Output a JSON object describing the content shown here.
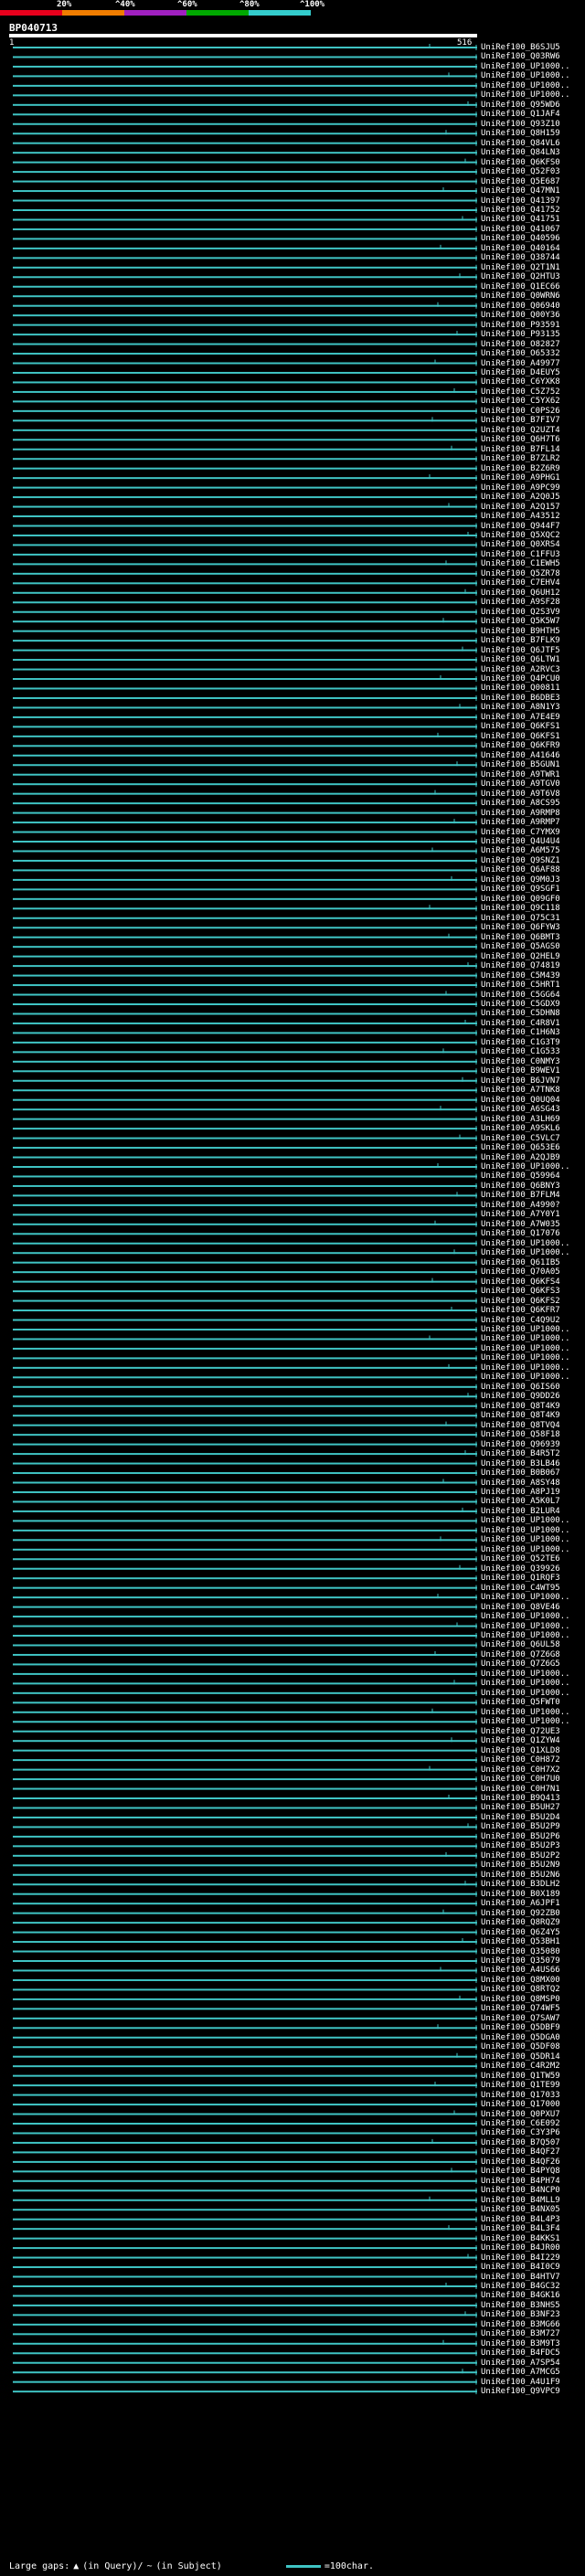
{
  "scale": {
    "labels": [
      "20%",
      "^40%",
      "^60%",
      "^80%",
      "^100%"
    ],
    "colors": [
      "#e8001c",
      "#f07d00",
      "#a020c0",
      "#00a800",
      "#33cccc"
    ]
  },
  "query": {
    "id": "BP040713",
    "start": "1",
    "end": "516"
  },
  "hit_color": "#3fc4c4",
  "hits": [
    "UniRef100_B6SJU5",
    "UniRef100_Q03RW6",
    "UniRef100_UP1000..",
    "UniRef100_UP1000..",
    "UniRef100_UP1000..",
    "UniRef100_UP1000..",
    "UniRef100_Q95WD6",
    "UniRef100_Q1JAF4",
    "UniRef100_Q93Z10",
    "UniRef100_Q8H159",
    "UniRef100_Q84VL6",
    "UniRef100_Q84LN3",
    "UniRef100_Q6KFS0",
    "UniRef100_Q52F03",
    "UniRef100_Q5E687",
    "UniRef100_Q47MN1",
    "UniRef100_Q41397",
    "UniRef100_Q41752",
    "UniRef100_Q41751",
    "UniRef100_Q41067",
    "UniRef100_Q40596",
    "UniRef100_Q40164",
    "UniRef100_Q38744",
    "UniRef100_Q2T1N1",
    "UniRef100_Q2HTU3",
    "UniRef100_Q1EC66",
    "UniRef100_Q0WRN6",
    "UniRef100_Q06940",
    "UniRef100_Q00Y36",
    "UniRef100_P93591",
    "UniRef100_P93135",
    "UniRef100_O82827",
    "UniRef100_O65332",
    "UniRef100_A49977",
    "UniRef100_D4EUY5",
    "UniRef100_C6YXK8",
    "UniRef100_C5Z752",
    "UniRef100_C5YX62",
    "UniRef100_C0PS26",
    "UniRef100_B7FIV7",
    "UniRef100_Q2UZT4",
    "UniRef100_Q6H7T6",
    "UniRef100_B7FL14",
    "UniRef100_B7ZLR2",
    "UniRef100_B2Z6R9",
    "UniRef100_A9PHG1",
    "UniRef100_A9PC99",
    "UniRef100_A2Q0J5",
    "UniRef100_A2Q157",
    "UniRef100_A43512",
    "UniRef100_Q944F7",
    "UniRef100_Q5XQC2",
    "UniRef100_Q0XRS4",
    "UniRef100_C1FFU3",
    "UniRef100_C1EWH5",
    "UniRef100_Q5ZR78",
    "UniRef100_C7EHV4",
    "UniRef100_Q6UH12",
    "UniRef100_A9SF28",
    "UniRef100_Q2S3V9",
    "UniRef100_Q5K5W7",
    "UniRef100_B9HTH5",
    "UniRef100_B7FLK9",
    "UniRef100_Q6JTF5",
    "UniRef100_Q6LTW1",
    "UniRef100_A2RVC3",
    "UniRef100_Q4PCU0",
    "UniRef100_Q00811",
    "UniRef100_B6DBE3",
    "UniRef100_A8N1Y3",
    "UniRef100_A7E4E9",
    "UniRef100_Q6KFS1",
    "UniRef100_Q6KFS1",
    "UniRef100_Q6KFR9",
    "UniRef100_A41646",
    "UniRef100_B5GUN1",
    "UniRef100_A9TWR1",
    "UniRef100_A9TGV0",
    "UniRef100_A9T6V8",
    "UniRef100_A8CS95",
    "UniRef100_A9RMP8",
    "UniRef100_A9RMP7",
    "UniRef100_C7YMX9",
    "UniRef100_Q4U4U4",
    "UniRef100_A6M575",
    "UniRef100_Q9SNZ1",
    "UniRef100_Q6AF88",
    "UniRef100_Q9M0J3",
    "UniRef100_Q9SGF1",
    "UniRef100_Q09GF0",
    "UniRef100_Q9C118",
    "UniRef100_Q75C31",
    "UniRef100_Q6FYW3",
    "UniRef100_Q6BMT3",
    "UniRef100_Q5AGS0",
    "UniRef100_Q2HEL9",
    "UniRef100_Q74819",
    "UniRef100_C5M439",
    "UniRef100_C5HRT1",
    "UniRef100_C5GG64",
    "UniRef100_C5GDX9",
    "UniRef100_C5DHN8",
    "UniRef100_C4R8V1",
    "UniRef100_C1H6N3",
    "UniRef100_C1G3T9",
    "UniRef100_C1G533",
    "UniRef100_C0NMY3",
    "UniRef100_B9WEV1",
    "UniRef100_B6JVN7",
    "UniRef100_A7TNK8",
    "UniRef100_Q0UQ04",
    "UniRef100_A6SG43",
    "UniRef100_A3LH69",
    "UniRef100_A9SKL6",
    "UniRef100_C5VLC7",
    "UniRef100_Q653E6",
    "UniRef100_A2QJB9",
    "UniRef100_UP1000..",
    "UniRef100_Q59964",
    "UniRef100_Q6BNY3",
    "UniRef100_B7FLM4",
    "UniRef100_A4990?",
    "UniRef100_A7Y0Y1",
    "UniRef100_A7W035",
    "UniRef100_Q17076",
    "UniRef100_UP1000..",
    "UniRef100_UP1000..",
    "UniRef100_Q61IB5",
    "UniRef100_Q70A05",
    "UniRef100_Q6KFS4",
    "UniRef100_Q6KFS3",
    "UniRef100_Q6KFS2",
    "UniRef100_Q6KFR7",
    "UniRef100_C4Q9U2",
    "UniRef100_UP1000..",
    "UniRef100_UP1000..",
    "UniRef100_UP1000..",
    "UniRef100_UP1000..",
    "UniRef100_UP1000..",
    "UniRef100_UP1000..",
    "UniRef100_Q6IS60",
    "UniRef100_Q9DD26",
    "UniRef100_Q8T4K9",
    "UniRef100_Q8T4K9",
    "UniRef100_Q8TVQ4",
    "UniRef100_Q58F18",
    "UniRef100_Q96939",
    "UniRef100_B4R5T2",
    "UniRef100_B3LB46",
    "UniRef100_B0B067",
    "UniRef100_A8SY48",
    "UniRef100_A8PJ19",
    "UniRef100_A5K0L7",
    "UniRef100_B2LUR4",
    "UniRef100_UP1000..",
    "UniRef100_UP1000..",
    "UniRef100_UP1000..",
    "UniRef100_UP1000..",
    "UniRef100_Q52TE6",
    "UniRef100_Q39926",
    "UniRef100_Q1RQF3",
    "UniRef100_C4WT95",
    "UniRef100_UP1000..",
    "UniRef100_Q8VE46",
    "UniRef100_UP1000..",
    "UniRef100_UP1000..",
    "UniRef100_UP1000..",
    "UniRef100_Q6UL58",
    "UniRef100_Q7Z6G8",
    "UniRef100_Q7Z6G5",
    "UniRef100_UP1000..",
    "UniRef100_UP1000..",
    "UniRef100_UP1000..",
    "UniRef100_Q5FWT0",
    "UniRef100_UP1000..",
    "UniRef100_UP1000..",
    "UniRef100_Q72UE3",
    "UniRef100_Q1ZYW4",
    "UniRef100_Q1XLD8",
    "UniRef100_C0H872",
    "UniRef100_C0H7X2",
    "UniRef100_C0H7U0",
    "UniRef100_C0H7N1",
    "UniRef100_B9Q413",
    "UniRef100_B5UH27",
    "UniRef100_B5U2D4",
    "UniRef100_B5U2P9",
    "UniRef100_B5U2P6",
    "UniRef100_B5U2P3",
    "UniRef100_B5U2P2",
    "UniRef100_B5U2N9",
    "UniRef100_B5U2N6",
    "UniRef100_B3DLH2",
    "UniRef100_B0X189",
    "UniRef100_A6JPF1",
    "UniRef100_Q92ZB0",
    "UniRef100_Q8RQZ9",
    "UniRef100_Q6Z4Y5",
    "UniRef100_Q53BH1",
    "UniRef100_Q35080",
    "UniRef100_Q35079",
    "UniRef100_A4US66",
    "UniRef100_Q8MX00",
    "UniRef100_Q8RTQ2",
    "UniRef100_Q8MSP0",
    "UniRef100_Q74WF5",
    "UniRef100_Q7SAW7",
    "UniRef100_Q5DBF9",
    "UniRef100_Q5DGA0",
    "UniRef100_Q5DF08",
    "UniRef100_Q5DR14",
    "UniRef100_C4R2M2",
    "UniRef100_Q1TW59",
    "UniRef100_Q1TE99",
    "UniRef100_Q17033",
    "UniRef100_Q17000",
    "UniRef100_Q0PXU7",
    "UniRef100_C6E092",
    "UniRef100_C3Y3P6",
    "UniRef100_B7Q507",
    "UniRef100_B4QF27",
    "UniRef100_B4QF26",
    "UniRef100_B4PYQ8",
    "UniRef100_B4PH74",
    "UniRef100_B4NCP0",
    "UniRef100_B4MLL9",
    "UniRef100_B4NX05",
    "UniRef100_B4L4P3",
    "UniRef100_B4L3F4",
    "UniRef100_B4KKS1",
    "UniRef100_B4JR00",
    "UniRef100_B4I229",
    "UniRef100_B4I0C9",
    "UniRef100_B4HTV7",
    "UniRef100_B4GC32",
    "UniRef100_B4GK16",
    "UniRef100_B3NHS5",
    "UniRef100_B3NF23",
    "UniRef100_B3MG66",
    "UniRef100_B3M727",
    "UniRef100_B3M9T3",
    "UniRef100_B4FDC5",
    "UniRef100_A7SP54",
    "UniRef100_A7MCG5",
    "UniRef100_A4U1F9",
    "UniRef100_Q9VPC9"
  ],
  "legend": {
    "large_gaps": "Large gaps:",
    "in_query": "(in Query)/",
    "in_subject": "(in Subject)",
    "scale_text": "=100char."
  }
}
